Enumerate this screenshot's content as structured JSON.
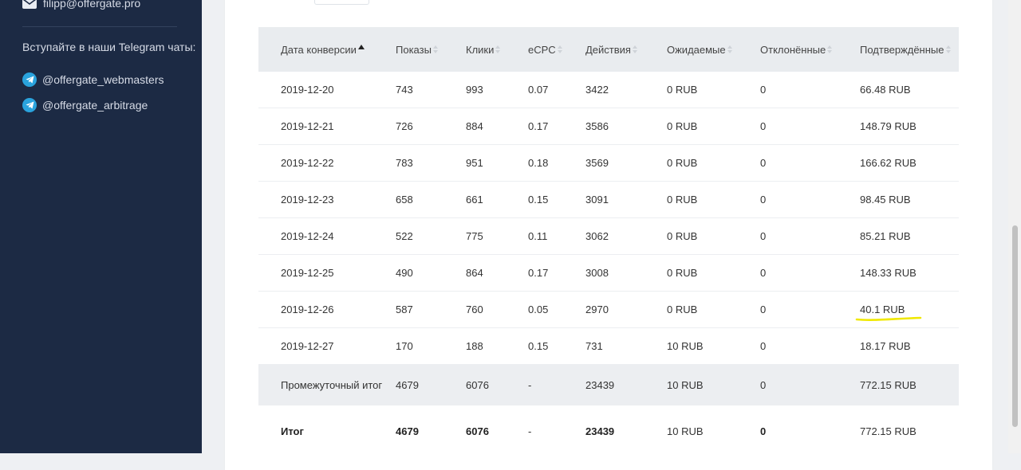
{
  "sidebar": {
    "email": "filipp@offergate.pro",
    "join_text": "Вступайте в наши Telegram чаты:",
    "telegram_links": [
      {
        "label": "@offergate_webmasters",
        "icon": "telegram-icon"
      },
      {
        "label": "@offergate_arbitrage",
        "icon": "telegram-icon"
      }
    ]
  },
  "colors": {
    "sidebar_bg": "#1c2a44",
    "header_bg": "#e9ecef",
    "subtotal_bg": "#eceef1",
    "telegram": "#2aa3dd",
    "highlight": "#f0e800"
  },
  "table": {
    "columns": [
      "Дата конверсии",
      "Показы",
      "Клики",
      "eCPC",
      "Действия",
      "Ожидаемые",
      "Отклонённые",
      "Подтверждённые"
    ],
    "sorted_column": "Дата конверсии",
    "sort_direction": "asc",
    "rows": [
      [
        "2019-12-20",
        "743",
        "993",
        "0.07",
        "3422",
        "0 RUB",
        "0",
        "66.48 RUB"
      ],
      [
        "2019-12-21",
        "726",
        "884",
        "0.17",
        "3586",
        "0 RUB",
        "0",
        "148.79 RUB"
      ],
      [
        "2019-12-22",
        "783",
        "951",
        "0.18",
        "3569",
        "0 RUB",
        "0",
        "166.62 RUB"
      ],
      [
        "2019-12-23",
        "658",
        "661",
        "0.15",
        "3091",
        "0 RUB",
        "0",
        "98.45 RUB"
      ],
      [
        "2019-12-24",
        "522",
        "775",
        "0.11",
        "3062",
        "0 RUB",
        "0",
        "85.21 RUB"
      ],
      [
        "2019-12-25",
        "490",
        "864",
        "0.17",
        "3008",
        "0 RUB",
        "0",
        "148.33 RUB"
      ],
      [
        "2019-12-26",
        "587",
        "760",
        "0.05",
        "2970",
        "0 RUB",
        "0",
        "40.1 RUB"
      ],
      [
        "2019-12-27",
        "170",
        "188",
        "0.15",
        "731",
        "10 RUB",
        "0",
        "18.17 RUB"
      ]
    ],
    "subtotal": [
      "Промежуточный итог",
      "4679",
      "6076",
      "-",
      "23439",
      "10 RUB",
      "0",
      "772.15 RUB"
    ],
    "total": [
      "Итог",
      "4679",
      "6076",
      "-",
      "23439",
      "10 RUB",
      "0",
      "772.15 RUB"
    ]
  }
}
